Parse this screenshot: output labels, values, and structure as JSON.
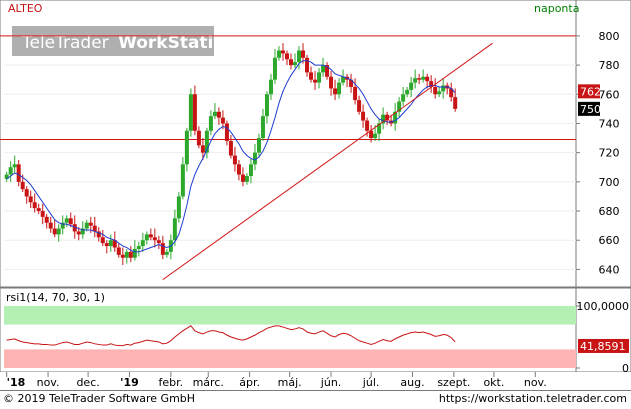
{
  "chart": {
    "symbol": "ALTEO",
    "period": "naponta",
    "watermark_brand": "TeleTrader",
    "watermark_product": "WorkStation",
    "price_axis_ticks": [
      "800",
      "780",
      "760",
      "740",
      "720",
      "700",
      "680",
      "660",
      "640"
    ],
    "price_axis_values": [
      800,
      780,
      760,
      740,
      720,
      700,
      680,
      660,
      640
    ],
    "price_badge_upper": "762",
    "price_badge_last": "750",
    "rsi_title": "rsi1(14, 70, 30, 1)",
    "rsi_axis_ticks": [
      "100,0000",
      "0"
    ],
    "rsi_badge": "41,8591",
    "time_labels": [
      "'18",
      "nov.",
      "dec.",
      "'19",
      "febr.",
      "márc.",
      "ápr.",
      "máj.",
      "jún.",
      "júl.",
      "aug.",
      "szept.",
      "okt.",
      "nov."
    ],
    "horizontal_levels": [
      800,
      729
    ],
    "colors": {
      "up_candle": "#2da82d",
      "down_candle": "#c81414",
      "moving_average": "#1e3cd2",
      "trend_line": "#d21414",
      "rsi_line": "#c81414",
      "rsi_overbought_band": "#b4f0b4",
      "rsi_oversold_band": "#ffb4b4",
      "symbol_text": "#c81414",
      "period_text": "#008000"
    }
  },
  "footer": {
    "copyright": "© 2019 TeleTrader Software GmbH",
    "url": "https://workstation.teletrader.com"
  },
  "chart_data": {
    "type": "candlestick",
    "title": "ALTEO",
    "y_range": [
      630,
      815
    ],
    "rsi_range": [
      0,
      100
    ],
    "dates": [
      "2018-10-01",
      "2018-10-04",
      "2018-10-07",
      "2018-10-10",
      "2018-10-13",
      "2018-10-16",
      "2018-10-19",
      "2018-10-22",
      "2018-10-25",
      "2018-10-28",
      "2018-10-31",
      "2018-11-03",
      "2018-11-06",
      "2018-11-09",
      "2018-11-12",
      "2018-11-15",
      "2018-11-18",
      "2018-11-21",
      "2018-11-24",
      "2018-11-27",
      "2018-11-30",
      "2018-12-03",
      "2018-12-06",
      "2018-12-09",
      "2018-12-12",
      "2018-12-15",
      "2018-12-18",
      "2018-12-21",
      "2018-12-24",
      "2018-12-27",
      "2018-12-30",
      "2019-01-02",
      "2019-01-05",
      "2019-01-08",
      "2019-01-11",
      "2019-01-14",
      "2019-01-17",
      "2019-01-20",
      "2019-01-23",
      "2019-01-26",
      "2019-01-29",
      "2019-02-01",
      "2019-02-04",
      "2019-02-07",
      "2019-02-10",
      "2019-02-13",
      "2019-02-16",
      "2019-02-19",
      "2019-02-22",
      "2019-02-25",
      "2019-02-28",
      "2019-03-03",
      "2019-03-06",
      "2019-03-09",
      "2019-03-12",
      "2019-03-15",
      "2019-03-18",
      "2019-03-21",
      "2019-03-24",
      "2019-03-27",
      "2019-03-30",
      "2019-04-02",
      "2019-04-05",
      "2019-04-08",
      "2019-04-11",
      "2019-04-14",
      "2019-04-17",
      "2019-04-20",
      "2019-04-23",
      "2019-04-26",
      "2019-04-29",
      "2019-05-02",
      "2019-05-05",
      "2019-05-08",
      "2019-05-11",
      "2019-05-14",
      "2019-05-17",
      "2019-05-20",
      "2019-05-23",
      "2019-05-26",
      "2019-05-29",
      "2019-06-01",
      "2019-06-04",
      "2019-06-07",
      "2019-06-10",
      "2019-06-13",
      "2019-06-16",
      "2019-06-19",
      "2019-06-22",
      "2019-06-25",
      "2019-06-28",
      "2019-07-01",
      "2019-07-04",
      "2019-07-07",
      "2019-07-10",
      "2019-07-13",
      "2019-07-16",
      "2019-07-19",
      "2019-07-22",
      "2019-07-25",
      "2019-07-28",
      "2019-07-31",
      "2019-08-03",
      "2019-08-06",
      "2019-08-09",
      "2019-08-12",
      "2019-08-15",
      "2019-08-18",
      "2019-08-21",
      "2019-08-24",
      "2019-08-27",
      "2019-08-30",
      "2019-09-02"
    ],
    "close": [
      705,
      710,
      712,
      700,
      695,
      690,
      686,
      682,
      680,
      676,
      672,
      668,
      664,
      668,
      672,
      675,
      671,
      666,
      664,
      668,
      672,
      670,
      666,
      662,
      658,
      656,
      660,
      655,
      650,
      648,
      652,
      648,
      654,
      656,
      660,
      664,
      662,
      660,
      658,
      650,
      652,
      660,
      675,
      690,
      712,
      735,
      760,
      735,
      725,
      720,
      735,
      745,
      748,
      744,
      740,
      728,
      718,
      712,
      705,
      700,
      704,
      712,
      720,
      730,
      745,
      760,
      770,
      785,
      790,
      788,
      784,
      780,
      782,
      790,
      785,
      775,
      770,
      768,
      775,
      780,
      772,
      764,
      760,
      768,
      772,
      770,
      765,
      756,
      748,
      742,
      735,
      730,
      733,
      740,
      746,
      742,
      740,
      748,
      755,
      760,
      763,
      768,
      771,
      770,
      772,
      769,
      765,
      760,
      762,
      766,
      764,
      758,
      750
    ],
    "ma": [
      702,
      704,
      706,
      705,
      703,
      701,
      698,
      694,
      690,
      686,
      682,
      678,
      674,
      672,
      671,
      671,
      670,
      669,
      668,
      667,
      667,
      667,
      666,
      665,
      664,
      662,
      661,
      660,
      658,
      656,
      655,
      653,
      652,
      652,
      653,
      654,
      655,
      656,
      657,
      656,
      655,
      656,
      659,
      664,
      673,
      684,
      697,
      705,
      711,
      716,
      722,
      728,
      733,
      736,
      738,
      737,
      734,
      730,
      726,
      721,
      718,
      716,
      715,
      717,
      721,
      727,
      735,
      744,
      754,
      762,
      768,
      773,
      777,
      781,
      783,
      783,
      782,
      780,
      780,
      780,
      779,
      777,
      774,
      773,
      772,
      771,
      770,
      767,
      764,
      760,
      755,
      750,
      746,
      743,
      742,
      741,
      741,
      742,
      744,
      747,
      750,
      753,
      757,
      760,
      763,
      765,
      766,
      766,
      765,
      765,
      765,
      764,
      761
    ],
    "rsi": [
      45,
      46,
      47,
      44,
      42,
      41,
      40,
      39,
      39,
      38,
      38,
      37,
      37,
      39,
      41,
      42,
      40,
      38,
      38,
      40,
      42,
      41,
      39,
      38,
      37,
      37,
      39,
      37,
      36,
      36,
      38,
      37,
      40,
      41,
      43,
      45,
      44,
      43,
      42,
      39,
      40,
      44,
      50,
      55,
      60,
      64,
      68,
      60,
      57,
      55,
      58,
      60,
      60,
      58,
      57,
      53,
      50,
      48,
      46,
      45,
      47,
      50,
      53,
      57,
      60,
      64,
      66,
      68,
      68,
      66,
      64,
      62,
      63,
      65,
      63,
      58,
      56,
      55,
      58,
      60,
      56,
      52,
      50,
      54,
      56,
      55,
      52,
      48,
      44,
      42,
      40,
      38,
      40,
      43,
      46,
      44,
      43,
      47,
      50,
      53,
      55,
      57,
      58,
      57,
      58,
      56,
      54,
      51,
      52,
      54,
      53,
      49,
      42
    ],
    "horizontal_lines": [
      800,
      729
    ],
    "trend_line": {
      "from": [
        "2019-01-26",
        633
      ],
      "to": [
        "2019-09-30",
        795
      ]
    },
    "rsi_bands": {
      "overbought": 70,
      "oversold": 30
    }
  }
}
